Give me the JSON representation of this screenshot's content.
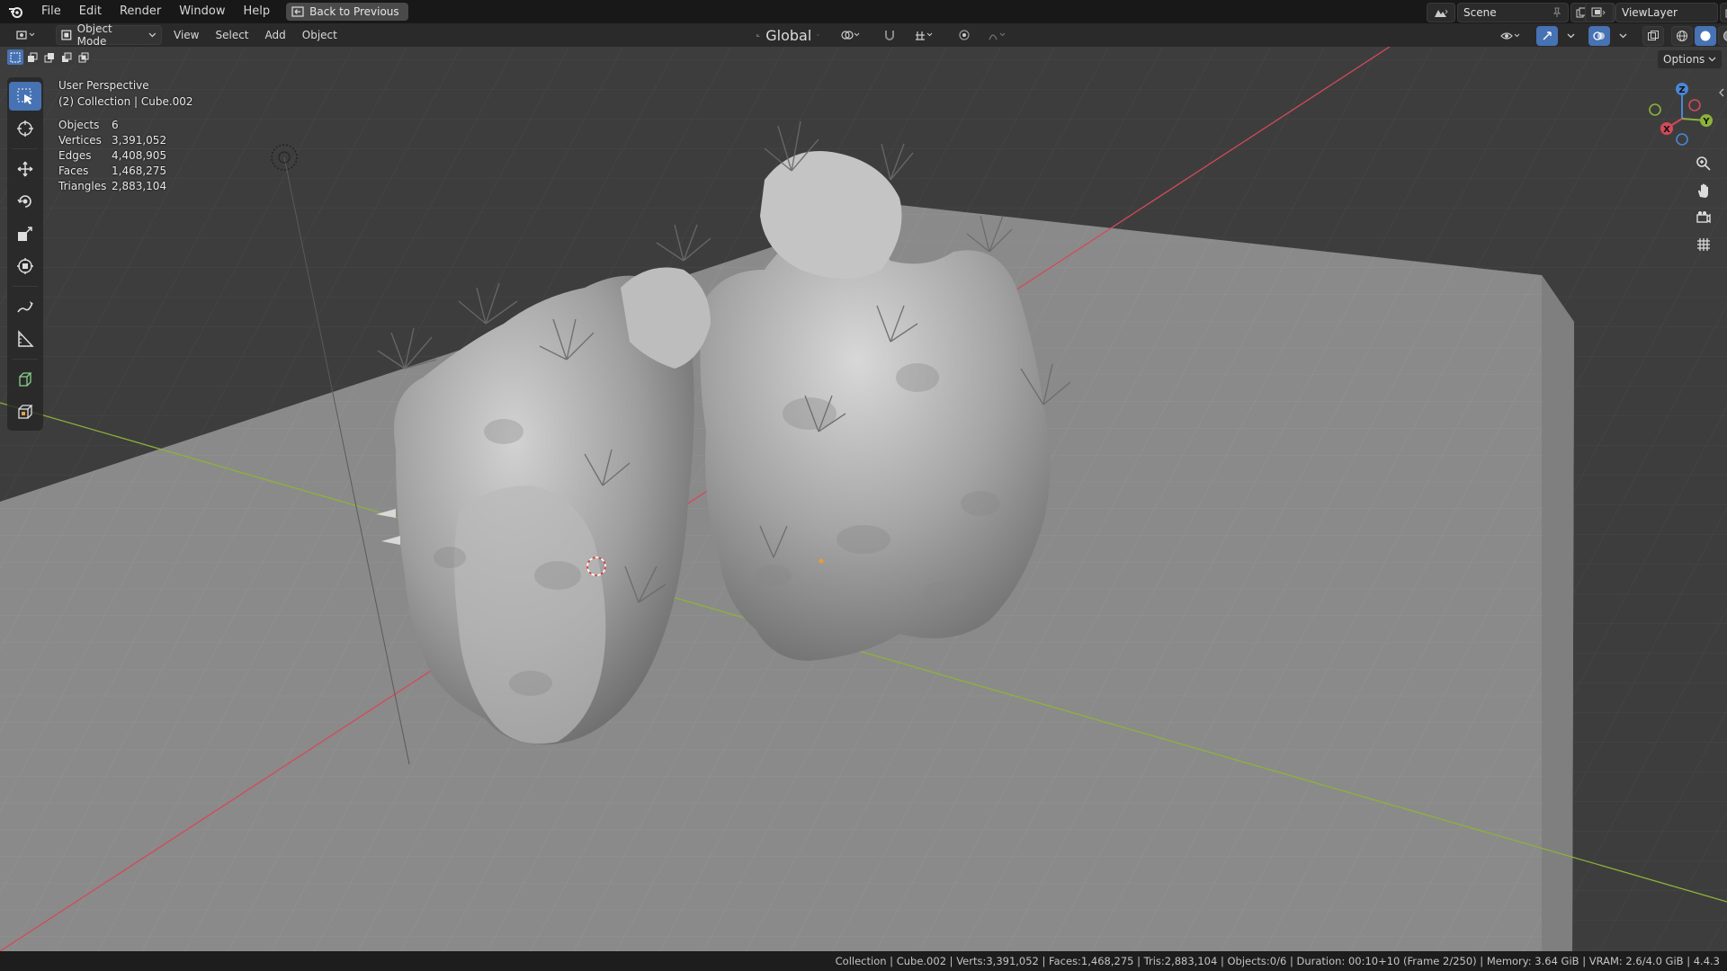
{
  "topbar": {
    "menus": [
      "File",
      "Edit",
      "Render",
      "Window",
      "Help"
    ],
    "back_label": "Back to Previous",
    "scene_name": "Scene",
    "viewlayer_name": "ViewLayer"
  },
  "header": {
    "mode": "Object Mode",
    "menus": [
      "View",
      "Select",
      "Add",
      "Object"
    ],
    "transform_orientation": "Global",
    "options_label": "Options"
  },
  "overlay": {
    "perspective": "User Perspective",
    "collection": "(2) Collection | Cube.002",
    "stats": [
      {
        "label": "Objects",
        "value": "6"
      },
      {
        "label": "Vertices",
        "value": "3,391,052"
      },
      {
        "label": "Edges",
        "value": "4,408,905"
      },
      {
        "label": "Faces",
        "value": "1,468,275"
      },
      {
        "label": "Triangles",
        "value": "2,883,104"
      }
    ]
  },
  "gizmo": {
    "x": "X",
    "y": "Y",
    "z": "Z"
  },
  "statusbar": {
    "text": "Collection | Cube.002 | Verts:3,391,052 | Faces:1,468,275 | Tris:2,883,104 | Objects:0/6 | Duration: 00:10+10 (Frame 2/250) | Memory: 3.64 GiB | VRAM: 2.6/4.0 GiB | 4.4.3"
  },
  "colors": {
    "accent": "#4772b3",
    "x_axis": "#d34a5a",
    "y_axis": "#8bb33a",
    "z_axis": "#4a86d6"
  },
  "icons": [
    "blender-logo",
    "back-icon",
    "scene-icon",
    "pin-icon",
    "copy-icon",
    "close-icon",
    "viewlayer-icon",
    "editor-type-icon",
    "object-mode-icon",
    "orientation-icon",
    "pivot-icon",
    "snap-icon",
    "proportional-icon",
    "visibility-icon",
    "gizmo-icon",
    "overlay-icon",
    "xray-icon",
    "shading-wireframe-icon",
    "shading-solid-icon",
    "shading-material-icon",
    "shading-rendered-icon",
    "select-box-icon",
    "cursor-icon",
    "move-icon",
    "rotate-icon",
    "scale-icon",
    "transform-icon",
    "annotate-icon",
    "measure-icon",
    "add-cube-icon",
    "add-object-icon",
    "zoom-icon",
    "hand-icon",
    "camera-icon",
    "grid-icon"
  ]
}
